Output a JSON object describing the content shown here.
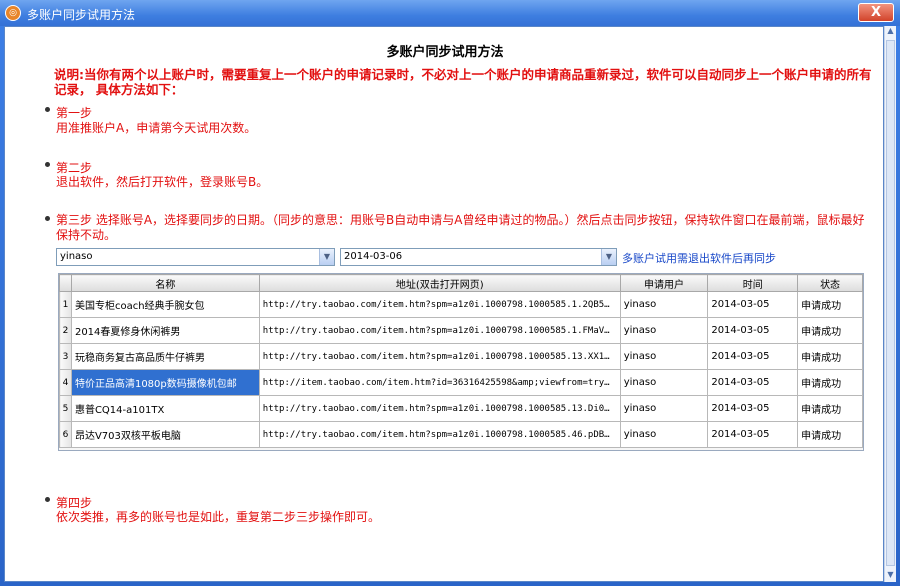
{
  "window": {
    "title": "多账户同步试用方法",
    "close_label": "X"
  },
  "heading": "多账户同步试用方法",
  "notice": "说明:当你有两个以上账户时，需要重复上一个账户的申请记录时，不必对上一个账户的申请商品重新录过，软件可以自动同步上一个账户申请的所有记录，  具体方法如下：",
  "steps": [
    {
      "title": "第一步",
      "desc": "用准推账户A，申请第今天试用次数。"
    },
    {
      "title": "第二步",
      "desc": "退出软件，然后打开软件，登录账号B。"
    },
    {
      "title": "第三步",
      "desc": "第三步 选择账号A，选择要同步的日期。（同步的意思：用账号B自动申请与A曾经申请过的物品。）然后点击同步按钮，保持软件窗口在最前端，鼠标最好保持不动。"
    },
    {
      "title": "第四步",
      "desc": "依次类推，再多的账号也是如此，重复第二步三步操作即可。"
    }
  ],
  "controls": {
    "account_value": "yinaso",
    "date_value": "2014-03-06",
    "link_text": "多账户试用需退出软件后再同步"
  },
  "grid": {
    "columns": [
      "",
      "名称",
      "地址(双击打开网页)",
      "申请用户",
      "时间",
      "状态"
    ],
    "rows": [
      {
        "num": "1",
        "name": "美国专柜coach经典手腕女包",
        "url": "http://try.taobao.com/item.htm?spm=a1z0i.1000798.1000585.1.2QB5…",
        "user": "yinaso",
        "time": "2014-03-05",
        "status": "申请成功"
      },
      {
        "num": "2",
        "name": "2014春夏修身休闲裤男",
        "url": "http://try.taobao.com/item.htm?spm=a1z0i.1000798.1000585.1.FMaV…",
        "user": "yinaso",
        "time": "2014-03-05",
        "status": "申请成功"
      },
      {
        "num": "3",
        "name": "玩稳商务复古高品质牛仔裤男",
        "url": "http://try.taobao.com/item.htm?spm=a1z0i.1000798.1000585.13.XX1…",
        "user": "yinaso",
        "time": "2014-03-05",
        "status": "申请成功"
      },
      {
        "num": "4",
        "name": "特价正品高清1080p数码摄像机包邮",
        "url": "http://item.taobao.com/item.htm?id=36316425598&amp;viewfrom=try…",
        "user": "yinaso",
        "time": "2014-03-05",
        "status": "申请成功"
      },
      {
        "num": "5",
        "name": "惠普CQ14-a101TX",
        "url": "http://try.taobao.com/item.htm?spm=a1z0i.1000798.1000585.13.Di0…",
        "user": "yinaso",
        "time": "2014-03-05",
        "status": "申请成功"
      },
      {
        "num": "6",
        "name": "昂达V703双核平板电脑",
        "url": "http://try.taobao.com/item.htm?spm=a1z0i.1000798.1000585.46.pDB…",
        "user": "yinaso",
        "time": "2014-03-05",
        "status": "申请成功"
      }
    ]
  },
  "colors": {
    "accent_red": "#e21010",
    "title_blue": "#3e7ee0",
    "selection": "#3070d0"
  }
}
